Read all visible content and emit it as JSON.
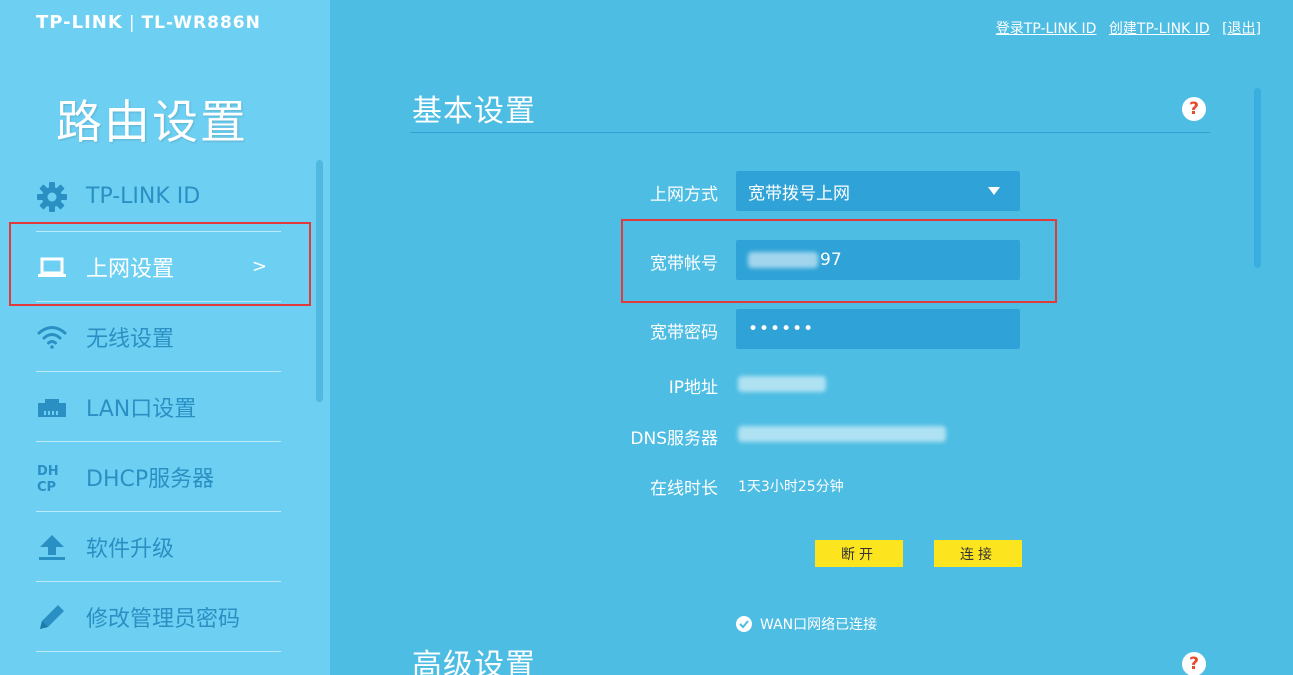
{
  "header": {
    "brand": "TP-LINK",
    "separator": "|",
    "model": "TL-WR886N",
    "links": {
      "login": "登录TP-LINK ID",
      "create": "创建TP-LINK ID",
      "logout": "[退出]"
    }
  },
  "sidebar": {
    "title": "路由设置",
    "items": [
      {
        "label": "TP-LINK ID",
        "icon": "gear-icon"
      },
      {
        "label": "上网设置",
        "icon": "laptop-icon",
        "active": true,
        "chevron": ">"
      },
      {
        "label": "无线设置",
        "icon": "wifi-icon"
      },
      {
        "label": "LAN口设置",
        "icon": "lan-port-icon"
      },
      {
        "label": "DHCP服务器",
        "icon": "dhcp-icon"
      },
      {
        "label": "软件升级",
        "icon": "upload-icon"
      },
      {
        "label": "修改管理员密码",
        "icon": "pencil-icon"
      }
    ]
  },
  "basic": {
    "title": "基本设置",
    "help": "?",
    "fields": {
      "connection_type_label": "上网方式",
      "connection_type_value": "宽带拨号上网",
      "account_label": "宽带帐号",
      "account_value": "97",
      "password_label": "宽带密码",
      "password_value": "••••••",
      "ip_label": "IP地址",
      "dns_label": "DNS服务器",
      "uptime_label": "在线时长",
      "uptime_value": "1天3小时25分钟"
    },
    "buttons": {
      "disconnect": "断开",
      "connect": "连接"
    },
    "status": "WAN口网络已连接"
  },
  "advanced": {
    "title": "高级设置",
    "help": "?"
  },
  "colors": {
    "main_bg": "#4dbde3",
    "sidebar_bg": "#6dd0f2",
    "field_bg": "#2fa3d7",
    "button_bg": "#fce51e",
    "highlight": "#e03a3a"
  }
}
